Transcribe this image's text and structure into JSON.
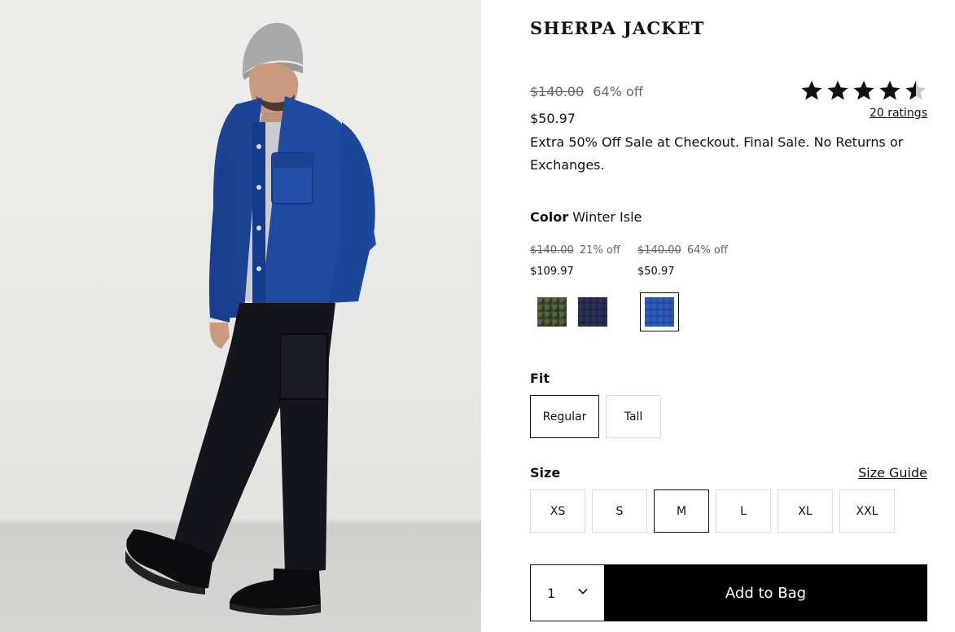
{
  "product": {
    "title": "SHERPA JACKET",
    "original_price": "$140.00",
    "discount": "64% off",
    "sale_price": "$50.97",
    "promo": "Extra 50% Off Sale at Checkout. Final Sale. No Returns or Exchanges.",
    "rating": 4.5,
    "ratings_label": "20 ratings"
  },
  "color": {
    "label": "Color",
    "selected": "Winter Isle",
    "variants": [
      {
        "original": "$140.00",
        "discount": "21% off",
        "price": "$109.97"
      },
      {
        "original": "$140.00",
        "discount": "64% off",
        "price": "$50.97"
      }
    ],
    "swatches": [
      {
        "name": "olive",
        "color": "#3f4a30",
        "selected": false
      },
      {
        "name": "navy",
        "color": "#1c2340",
        "selected": false
      },
      {
        "name": "winter-isle",
        "color": "#1f4aa0",
        "selected": true
      }
    ]
  },
  "fit": {
    "label": "Fit",
    "options": [
      "Regular",
      "Tall"
    ],
    "selected": "Regular"
  },
  "size": {
    "label": "Size",
    "guide_label": "Size Guide",
    "options": [
      "XS",
      "S",
      "M",
      "L",
      "XL",
      "XXL"
    ],
    "selected": "M"
  },
  "cart": {
    "quantity": "1",
    "add_label": "Add to Bag"
  },
  "icons": {
    "star": "star-icon",
    "chevron": "chevron-down-icon"
  }
}
